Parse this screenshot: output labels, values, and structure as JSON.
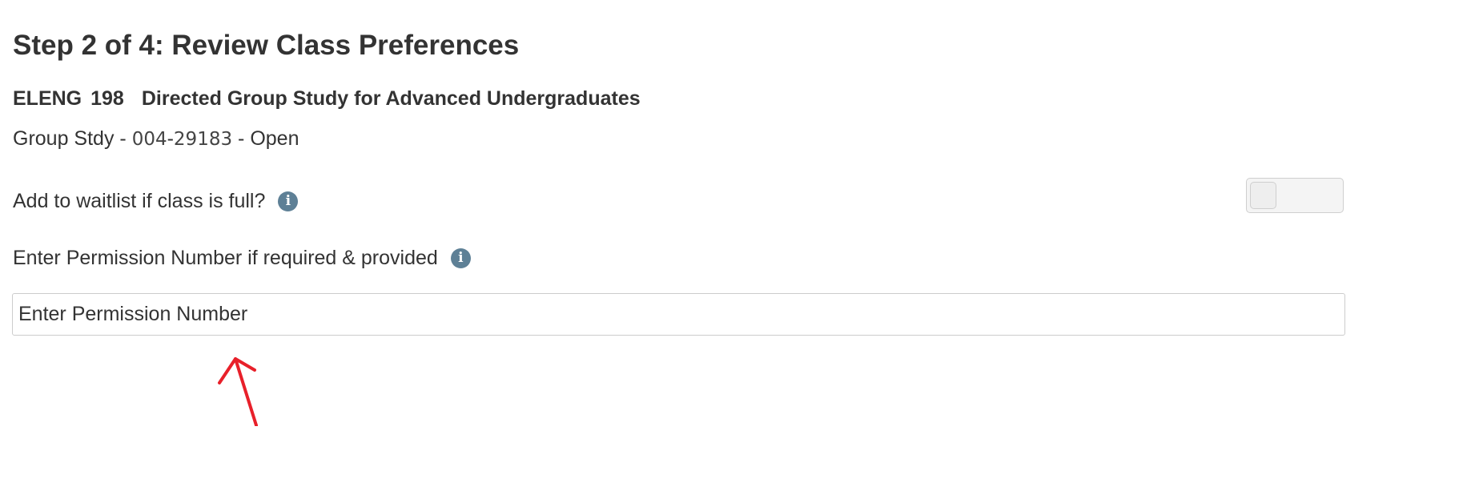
{
  "page": {
    "title": "Step 2 of 4: Review Class Preferences"
  },
  "course": {
    "subject": "ELENG",
    "number": "198",
    "name": "Directed Group Study for Advanced Undergraduates"
  },
  "section": {
    "type": "Group Stdy",
    "sep": "-",
    "section_number": "004",
    "class_number": "29183",
    "status": "Open"
  },
  "waitlist": {
    "label": "Add to waitlist if class is full?",
    "info_icon": "info-icon",
    "toggle_on": false
  },
  "permission": {
    "label": "Enter Permission Number if required & provided",
    "info_icon": "info-icon",
    "value": "",
    "placeholder": "Enter Permission Number"
  },
  "colors": {
    "text": "#333333",
    "info_icon_bg": "#5e8096",
    "annotation_arrow": "#e8202a"
  }
}
